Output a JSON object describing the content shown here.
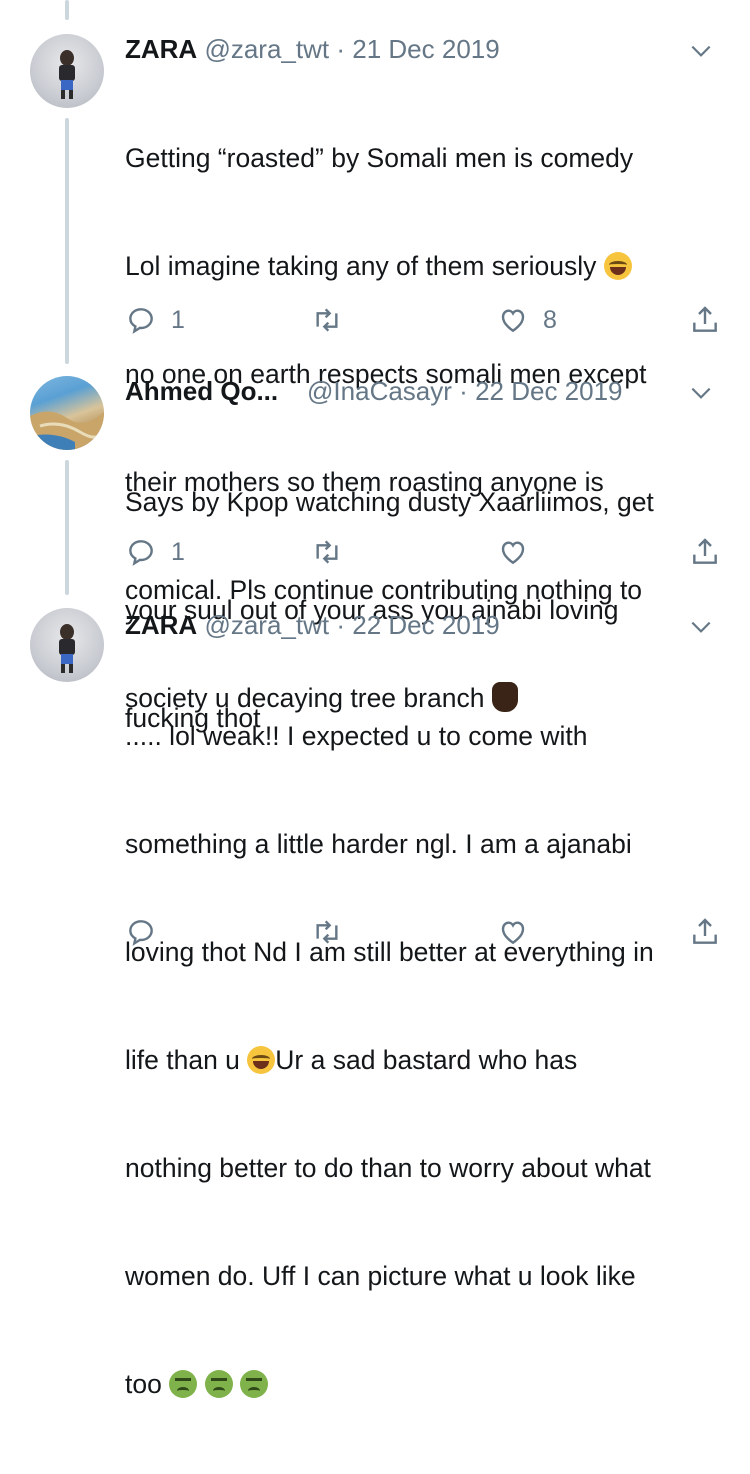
{
  "tweets": [
    {
      "name": "ZARA",
      "handle": "@zara_twt",
      "separator": "·",
      "date": "21 Dec 2019",
      "lines": [
        "Getting “roasted” by Somali men is comedy",
        "Lol imagine taking any of them seriously",
        "no one on earth respects somali men except",
        "their mothers so them roasting anyone is",
        "comical. Pls continue contributing nothing to",
        "society u decaying tree branch"
      ],
      "replies": "1",
      "retweets": "",
      "likes": "8"
    },
    {
      "name": "Ahmed Qo...",
      "handle": "@InaCasayr",
      "separator": "·",
      "date": "22 Dec 2019",
      "lines": [
        "Says by Kpop watching dusty Xaarliimos, get",
        "your suul out of your ass you ajnabi loving",
        "fucking thot"
      ],
      "replies": "1",
      "retweets": "",
      "likes": ""
    },
    {
      "name": "ZARA",
      "handle": "@zara_twt",
      "separator": "·",
      "date": "22 Dec 2019",
      "lines": [
        "..... lol weak!! I expected u to come with",
        "something a little harder ngl. I am a ajanabi",
        "loving thot Nd I am still better at everything in",
        "life than u",
        "Ur a sad bastard who has",
        "nothing better to do than to worry about what",
        "women do. Uff I can picture what u look like",
        "too"
      ],
      "replies": "",
      "retweets": "",
      "likes": ""
    }
  ],
  "icons": {
    "reply": "reply-icon",
    "retweet": "retweet-icon",
    "like": "heart-icon",
    "share": "share-icon",
    "caret": "chevron-down-icon"
  },
  "colors": {
    "text": "#14171a",
    "secondary": "#657786",
    "thread_line": "#ccd6dd"
  }
}
